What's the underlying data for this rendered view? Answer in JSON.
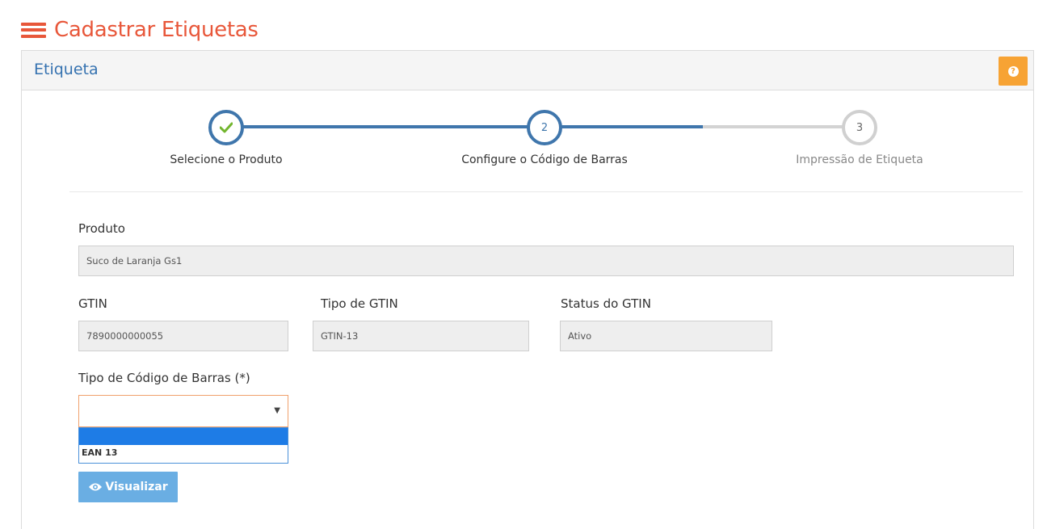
{
  "header": {
    "title": "Cadastrar Etiquetas"
  },
  "panel": {
    "title": "Etiqueta",
    "help_icon": "question-circle-icon"
  },
  "colors": {
    "accent": "#e8573a",
    "primary": "#3f76ac",
    "help": "#f7a334",
    "button": "#6aaee3"
  },
  "steps": [
    {
      "label": "Selecione o Produto",
      "marker": "✔",
      "state": "done"
    },
    {
      "label": "Configure o Código de Barras",
      "marker": "2",
      "state": "current"
    },
    {
      "label": "Impressão de Etiqueta",
      "marker": "3",
      "state": "pending"
    }
  ],
  "form": {
    "produto": {
      "label": "Produto",
      "value": "Suco de Laranja Gs1"
    },
    "gtin": {
      "label": "GTIN",
      "value": "7890000000055"
    },
    "tipo_gtin": {
      "label": "Tipo de GTIN",
      "value": "GTIN-13"
    },
    "status_gtin": {
      "label": "Status do GTIN",
      "value": "Ativo"
    },
    "tipo_codigo": {
      "label": "Tipo de Código de Barras (*)",
      "selected": "",
      "options": [
        "",
        "EAN 13"
      ]
    }
  },
  "buttons": {
    "visualizar": "Visualizar"
  }
}
